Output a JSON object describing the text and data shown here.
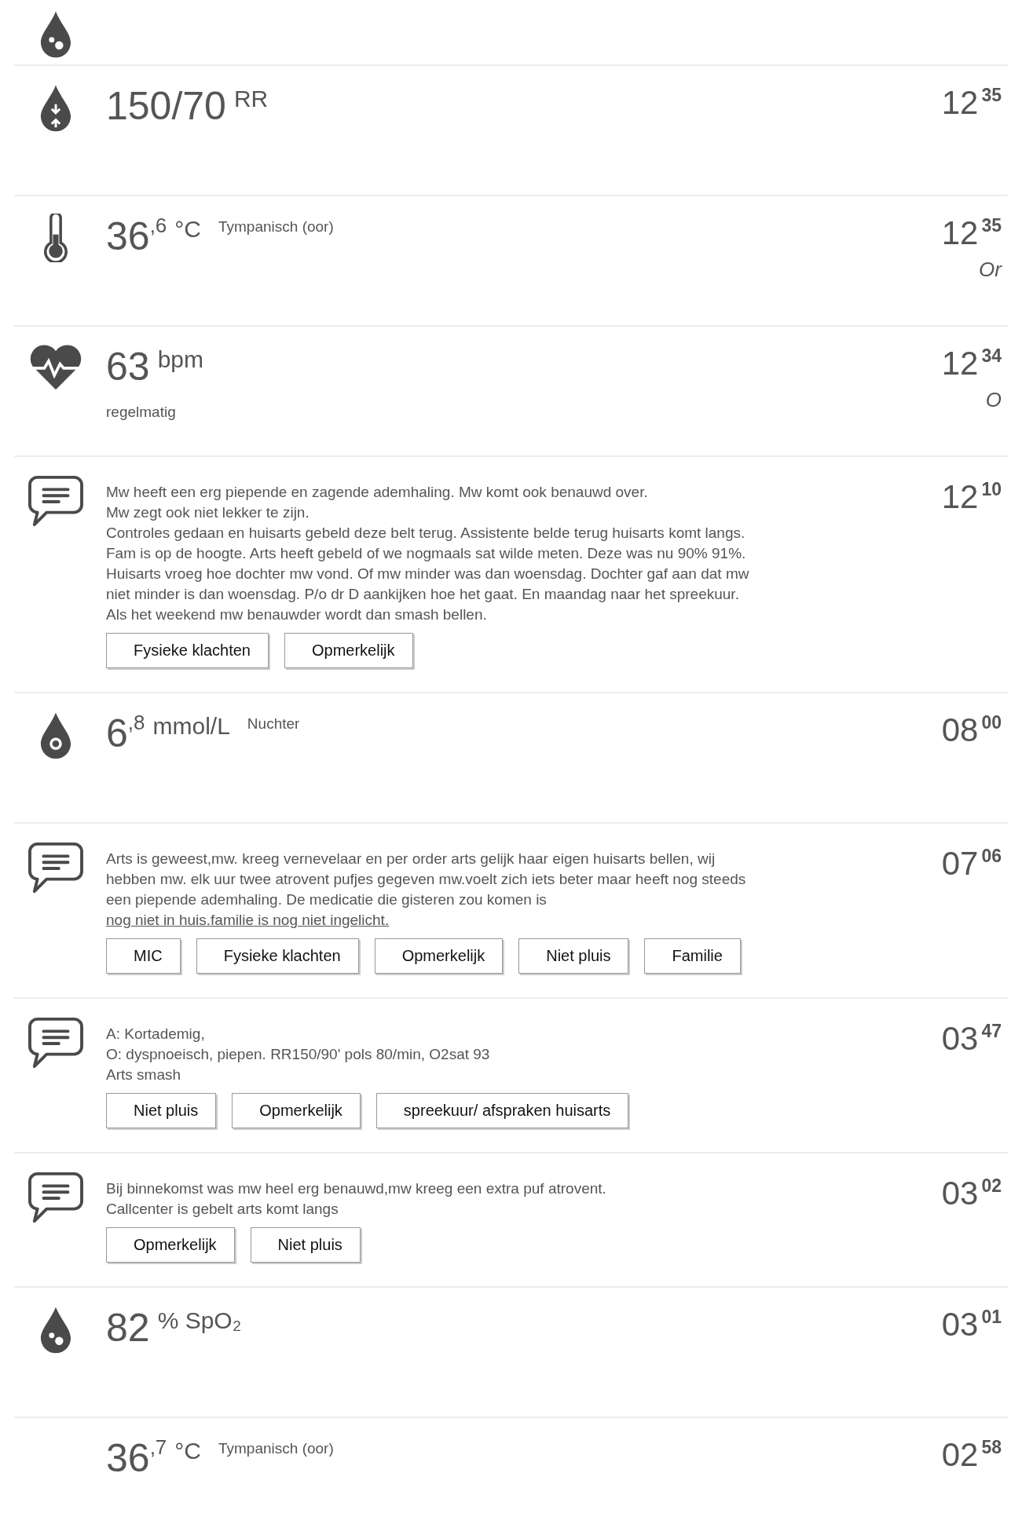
{
  "rows": [
    {
      "kind": "saturation"
    },
    {
      "kind": "blood-pressure",
      "value": "150/70",
      "unit": "RR",
      "time_h": "12",
      "time_m": "35"
    },
    {
      "kind": "temperature",
      "value": "36",
      "decimal": ",6",
      "unit": "°C",
      "method": "Tympanisch (oor)",
      "time_h": "12",
      "time_m": "35",
      "author": "Or"
    },
    {
      "kind": "pulse",
      "value": "63",
      "unit": "bpm",
      "remark": "regelmatig",
      "time_h": "12",
      "time_m": "34",
      "author": "O"
    },
    {
      "kind": "note",
      "text": "Mw heeft een erg piepende en zagende ademhaling. Mw komt ook benauwd over.\nMw zegt ook niet lekker te zijn.\nControles gedaan en huisarts gebeld deze belt terug. Assistente belde terug huisarts komt langs. Fam is op de hoogte. Arts heeft gebeld of we nogmaals sat wilde meten. Deze was nu 90% 91%. Huisarts vroeg hoe dochter mw vond. Of mw minder was dan woensdag. Dochter gaf aan dat mw niet minder is dan woensdag. P/o dr D aankijken hoe het gaat. En maandag naar het spreekuur. Als het weekend mw benauwder wordt dan smash bellen.",
      "tags": [
        "Fysieke klachten",
        "Opmerkelijk"
      ],
      "time_h": "12",
      "time_m": "10"
    },
    {
      "kind": "glucose",
      "value": "6",
      "decimal": ",8",
      "unit": "mmol/L",
      "method": "Nuchter",
      "time_h": "08",
      "time_m": "00"
    },
    {
      "kind": "note",
      "text": "Arts is geweest,mw. kreeg vernevelaar en per order arts gelijk haar eigen huisarts bellen, wij hebben mw. elk uur twee atrovent pufjes gegeven mw.voelt zich iets beter maar heeft nog steeds een piepende ademhaling. De medicatie die gisteren zou komen is ",
      "underlined": "nog niet in huis.familie is nog niet ingelicht.",
      "tags": [
        "MIC",
        "Fysieke klachten",
        "Opmerkelijk",
        "Niet pluis",
        "Familie"
      ],
      "time_h": "07",
      "time_m": "06"
    },
    {
      "kind": "note",
      "text": "A: Kortademig,\nO: dyspnoeisch, piepen. RR150/90' pols 80/min, O2sat 93\nArts smash",
      "tags": [
        "Niet pluis",
        "Opmerkelijk",
        "spreekuur/ afspraken huisarts"
      ],
      "time_h": "03",
      "time_m": "47"
    },
    {
      "kind": "note",
      "text": "Bij binnekomst was mw heel erg benauwd,mw kreeg een extra puf atrovent.\nCallcenter is gebelt arts komt langs",
      "tags": [
        "Opmerkelijk",
        "Niet pluis"
      ],
      "time_h": "03",
      "time_m": "02"
    },
    {
      "kind": "saturation",
      "value": "82",
      "unit": "% SpO₂",
      "time_h": "03",
      "time_m": "01"
    },
    {
      "kind": "reading",
      "value": "36",
      "decimal": ",7",
      "unit": "°C",
      "method": "Tympanisch (oor)",
      "time_h": "02",
      "time_m": "58"
    }
  ]
}
